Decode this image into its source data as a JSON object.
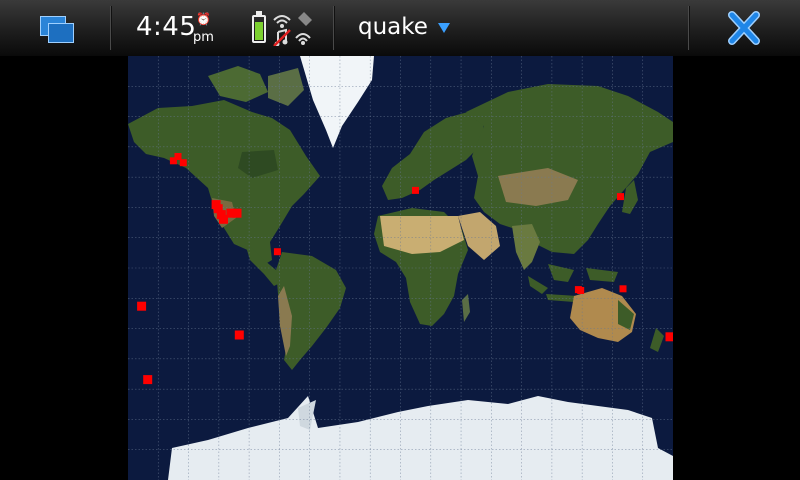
{
  "statusbar": {
    "time": "4:45",
    "ampm": "pm",
    "app_title": "quake",
    "icons": [
      "task-switcher-icon",
      "alarm-icon",
      "battery-icon",
      "wifi-icon",
      "network-icon",
      "dropdown-icon",
      "close-icon"
    ],
    "battery_level": 0.8
  },
  "map": {
    "ocean_color": "#0c1a3f",
    "grid_color": "#6a7a94",
    "land_color": "#3d5c28",
    "desert_color": "#bfa66a",
    "ice_color": "#e6ecf1",
    "marker_color": "#ff0000",
    "quakes": [
      {
        "lon": -150.0,
        "lat": 62.2
      },
      {
        "lon": -147.0,
        "lat": 63.5
      },
      {
        "lon": -143.5,
        "lat": 61.6
      },
      {
        "lon": -121.8,
        "lat": 45.4
      },
      {
        "lon": -120.4,
        "lat": 43.5
      },
      {
        "lon": -118.4,
        "lat": 40.6
      },
      {
        "lon": -116.9,
        "lat": 38.2
      },
      {
        "lon": -112.0,
        "lat": 41.3
      },
      {
        "lon": -108.0,
        "lat": 41.3
      },
      {
        "lon": -81.3,
        "lat": 19.6
      },
      {
        "lon": 9.9,
        "lat": 51.6
      },
      {
        "lon": 145.3,
        "lat": 49.0
      },
      {
        "lon": 117.5,
        "lat": -5.0
      },
      {
        "lon": 119.0,
        "lat": -5.6
      },
      {
        "lon": 147.0,
        "lat": -4.5
      },
      {
        "lon": 178.0,
        "lat": -34.0
      },
      {
        "lon": -171.0,
        "lat": -15.8
      },
      {
        "lon": -106.5,
        "lat": -33.0
      },
      {
        "lon": -167.0,
        "lat": -54.0
      }
    ]
  }
}
